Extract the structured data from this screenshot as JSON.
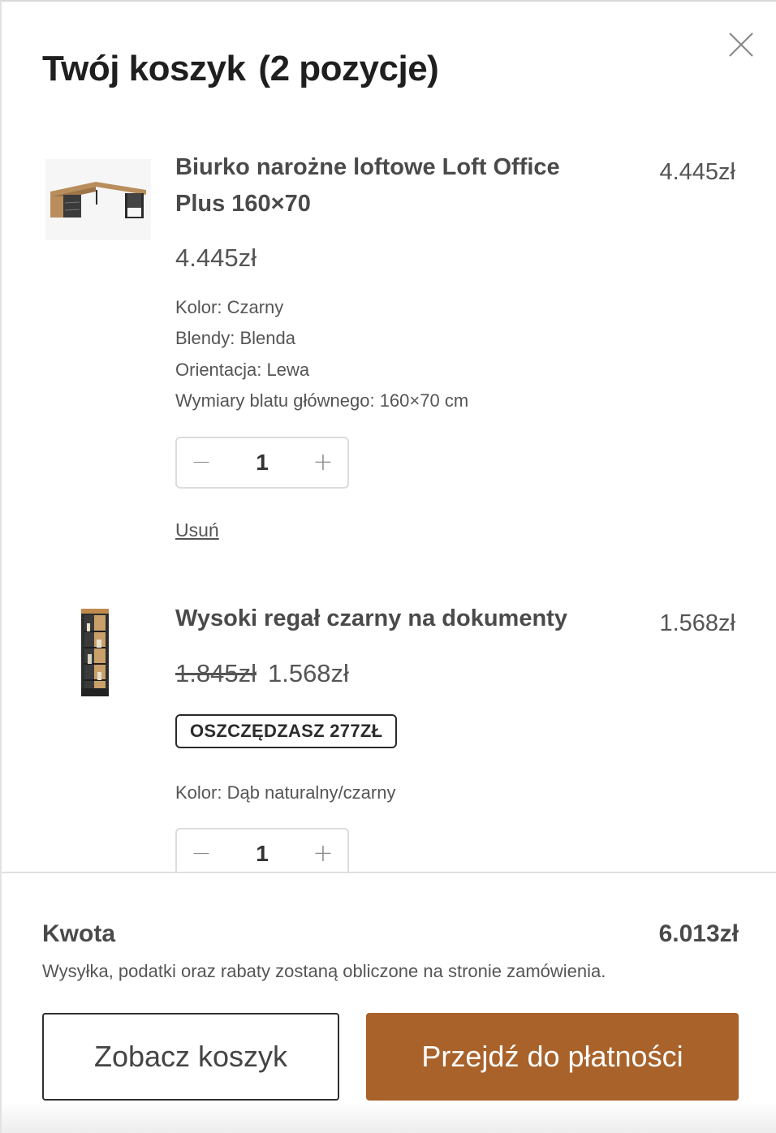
{
  "cart": {
    "title": "Twój koszyk",
    "count_label": "(2 pozycje)",
    "close_icon": "close-icon"
  },
  "items": [
    {
      "name_line1": "Biurko narożne loftowe Loft Office",
      "name_line2": "Plus 160×70",
      "line_price": "4.445zł",
      "price": "4.445zł",
      "attributes": [
        "Kolor: Czarny",
        "Blendy: Blenda",
        "Orientacja: Lewa",
        "Wymiary blatu głównego: 160×70 cm"
      ],
      "quantity": "1",
      "remove_label": "Usuń"
    },
    {
      "name_line1": "Wysoki regał czarny na dokumenty",
      "line_price": "1.568zł",
      "price_old": "1.845zł",
      "price": "1.568zł",
      "badge": "OSZCZĘDZASZ 277ZŁ",
      "attributes": [
        "Kolor: Dąb naturalny/czarny"
      ],
      "quantity": "1"
    }
  ],
  "qty_controls": {
    "minus": "−",
    "plus": "+"
  },
  "summary": {
    "total_label": "Kwota",
    "total_value": "6.013zł",
    "note": "Wysyłka, podatki oraz rabaty zostaną obliczone na stronie zamówienia.",
    "view_cart_label": "Zobacz koszyk",
    "checkout_label": "Przejdź do płatności"
  },
  "colors": {
    "accent": "#a8622a",
    "text": "#4a4a4a",
    "border": "#dcdcdc"
  }
}
